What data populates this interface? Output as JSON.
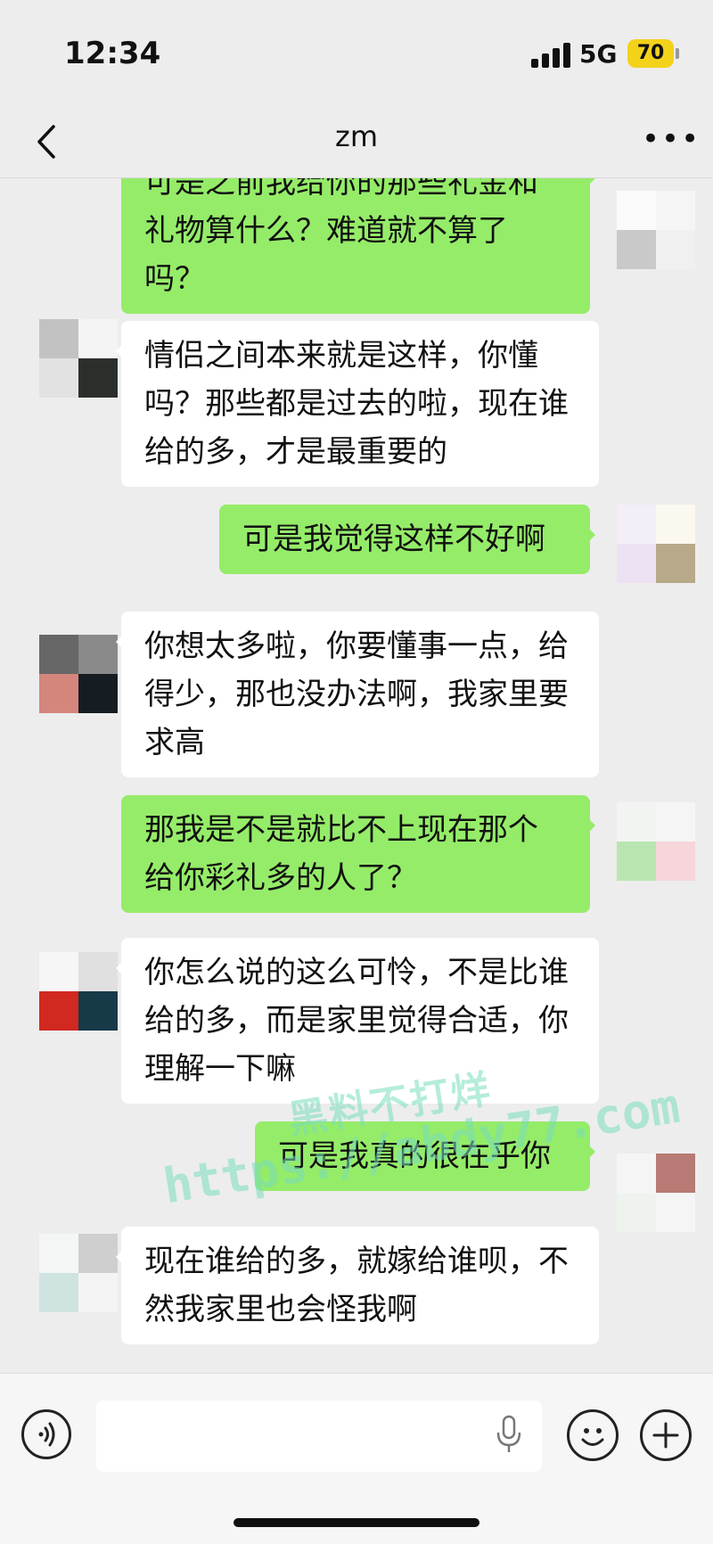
{
  "status_bar": {
    "time": "12:34",
    "network": "5G",
    "battery": "70"
  },
  "nav": {
    "title": "zm"
  },
  "messages": [
    {
      "side": "me",
      "text": "可是之前我给你的那些礼金和礼物算什么？难道就不算了吗？"
    },
    {
      "side": "other",
      "text": "情侣之间本来就是这样，你懂吗？那些都是过去的啦，现在谁给的多，才是最重要的"
    },
    {
      "side": "me",
      "text": "可是我觉得这样不好啊"
    },
    {
      "side": "other",
      "text": "你想太多啦，你要懂事一点，给得少，那也没办法啊，我家里要求高"
    },
    {
      "side": "me",
      "text": "那我是不是就比不上现在那个给你彩礼多的人了？"
    },
    {
      "side": "other",
      "text": "你怎么说的这么可怜，不是比谁给的多，而是家里觉得合适，你理解一下嘛"
    },
    {
      "side": "me",
      "text": "可是我真的很在乎你"
    },
    {
      "side": "other",
      "text": "现在谁给的多，就嫁给谁呗，不然我家里也会怪我啊"
    }
  ],
  "watermark": {
    "line1": "黑料不打烊",
    "line2": "https://abdy77.com"
  },
  "colors": {
    "sent_bubble": "#95ec69",
    "received_bubble": "#ffffff",
    "background": "#ededed"
  },
  "icons": [
    "back-arrow-icon",
    "more-icon",
    "voice-icon",
    "mic-icon",
    "emoji-icon",
    "plus-icon"
  ]
}
